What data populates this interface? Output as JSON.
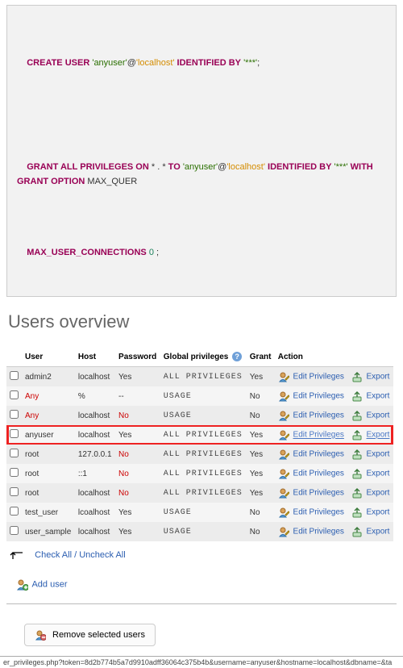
{
  "sql": {
    "line1": {
      "kw1": "CREATE",
      "kw2": "USER",
      "user": "'anyuser'",
      "at": "@",
      "host": "'localhost'",
      "kw3": "IDENTIFIED BY",
      "pw": "'***'",
      "end": ";"
    },
    "line2": {
      "kw1": "GRANT ALL PRIVILEGES ON",
      "star": "* . *",
      "kw2": "TO",
      "user": "'anyuser'",
      "at": "@",
      "host": "'localhost'",
      "kw3": "IDENTIFIED BY",
      "pw": "'***'",
      "kw4": "WITH GRANT OPTION",
      "tail": "MAX_QUER"
    },
    "line3": {
      "kw1": "MAX_USER_CONNECTIONS",
      "num": "0",
      "end": ";"
    }
  },
  "section_title": "Users overview",
  "table_headers": [
    "User",
    "Host",
    "Password",
    "Global privileges",
    "Grant",
    "Action"
  ],
  "help_char": "?",
  "rows": [
    {
      "user": "admin2",
      "host": "localhost",
      "pw": "Yes",
      "priv": "ALL PRIVILEGES",
      "grant": "Yes",
      "danger": false,
      "hl": false
    },
    {
      "user": "Any",
      "host": "%",
      "pw": "--",
      "priv": "USAGE",
      "grant": "No",
      "danger": true,
      "hl": false
    },
    {
      "user": "Any",
      "host": "localhost",
      "pw": "No",
      "priv": "USAGE",
      "grant": "No",
      "danger": true,
      "hl": false,
      "pw_danger": true
    },
    {
      "user": "anyuser",
      "host": "localhost",
      "pw": "Yes",
      "priv": "ALL PRIVILEGES",
      "grant": "Yes",
      "danger": false,
      "hl": true
    },
    {
      "user": "root",
      "host": "127.0.0.1",
      "pw": "No",
      "priv": "ALL PRIVILEGES",
      "grant": "Yes",
      "danger": false,
      "hl": false,
      "pw_danger": true
    },
    {
      "user": "root",
      "host": "::1",
      "pw": "No",
      "priv": "ALL PRIVILEGES",
      "grant": "Yes",
      "danger": false,
      "hl": false,
      "pw_danger": true
    },
    {
      "user": "root",
      "host": "localhost",
      "pw": "No",
      "priv": "ALL PRIVILEGES",
      "grant": "Yes",
      "danger": false,
      "hl": false,
      "pw_danger": true
    },
    {
      "user": "test_user",
      "host": "lcoalhost",
      "pw": "Yes",
      "priv": "USAGE",
      "grant": "No",
      "danger": false,
      "hl": false
    },
    {
      "user": "user_sample",
      "host": "localhost",
      "pw": "Yes",
      "priv": "USAGE",
      "grant": "No",
      "danger": false,
      "hl": false
    }
  ],
  "action_labels": {
    "edit": "Edit Privileges",
    "export": "Export"
  },
  "checkall": {
    "label": "Check All / Uncheck All"
  },
  "add_user": {
    "label": "Add user"
  },
  "remove_button": "Remove selected users",
  "footer_url": "er_privileges.php?token=8d2b774b5a7d9910adff36064c375b4b&username=anyuser&hostname=localhost&dbname=&ta",
  "icons": {
    "edit": "user-edit-icon",
    "export": "export-icon",
    "help": "help-icon",
    "adduser": "user-add-icon",
    "remove": "user-remove-icon"
  }
}
